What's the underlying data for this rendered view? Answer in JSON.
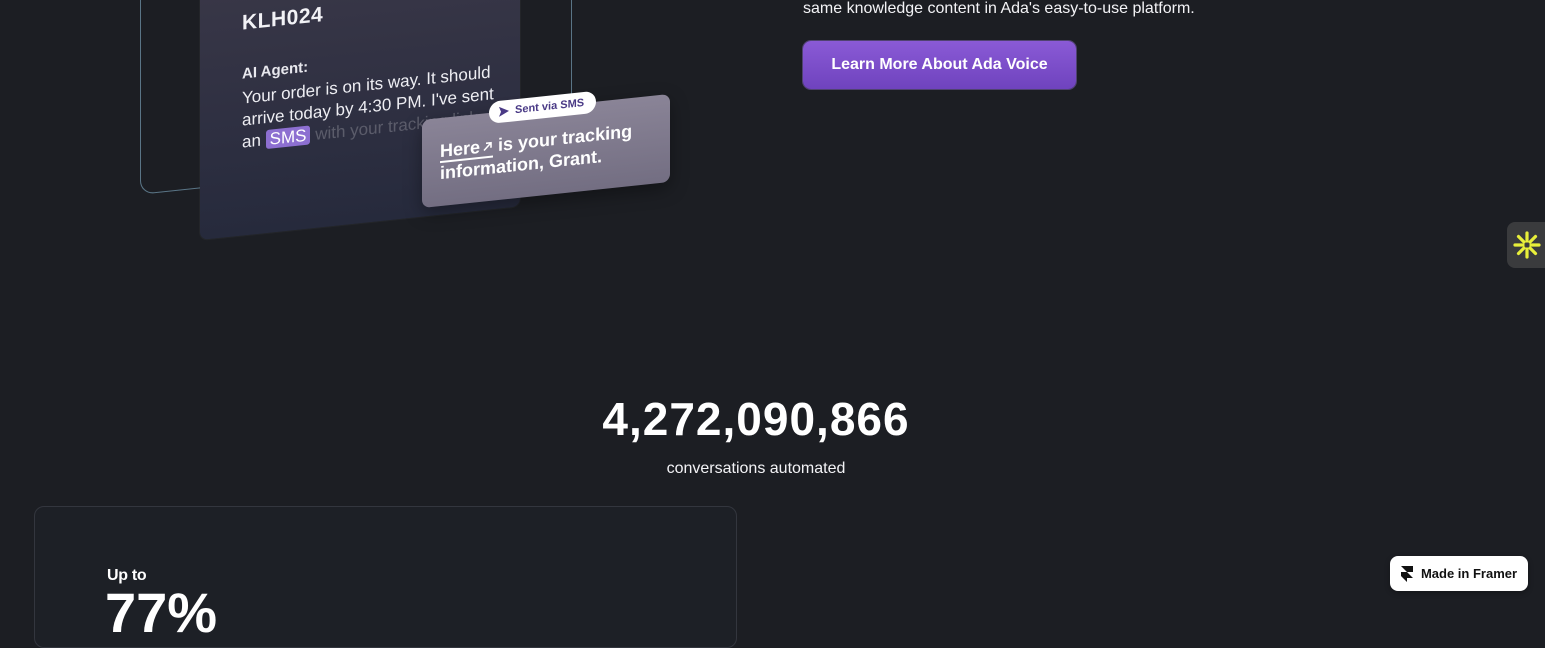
{
  "illustration": {
    "order_id": "KLH024",
    "agent_label": "AI Agent:",
    "message_part1": "Your order is on its way. It should arrive today by 4:30 PM. I've sent an ",
    "message_highlight": "SMS",
    "message_faded": " with your tracking link.",
    "sent_badge": "Sent via SMS",
    "bubble_link_word": "Here",
    "bubble_rest": " is your tracking information, Grant."
  },
  "hero": {
    "description": "same knowledge content in Ada's easy-to-use platform.",
    "cta_label": "Learn More About Ada Voice"
  },
  "stats": {
    "conversations_count": "4,272,090,866",
    "conversations_label": "conversations automated"
  },
  "metric_card": {
    "prefix": "Up to",
    "value": "77%"
  },
  "framer_badge": {
    "label": "Made in Framer"
  },
  "colors": {
    "background": "#1c1e23",
    "cta": "#7a4cc8",
    "sms_highlight": "#8d6fd1",
    "widget_star": "#e8ef3a"
  }
}
